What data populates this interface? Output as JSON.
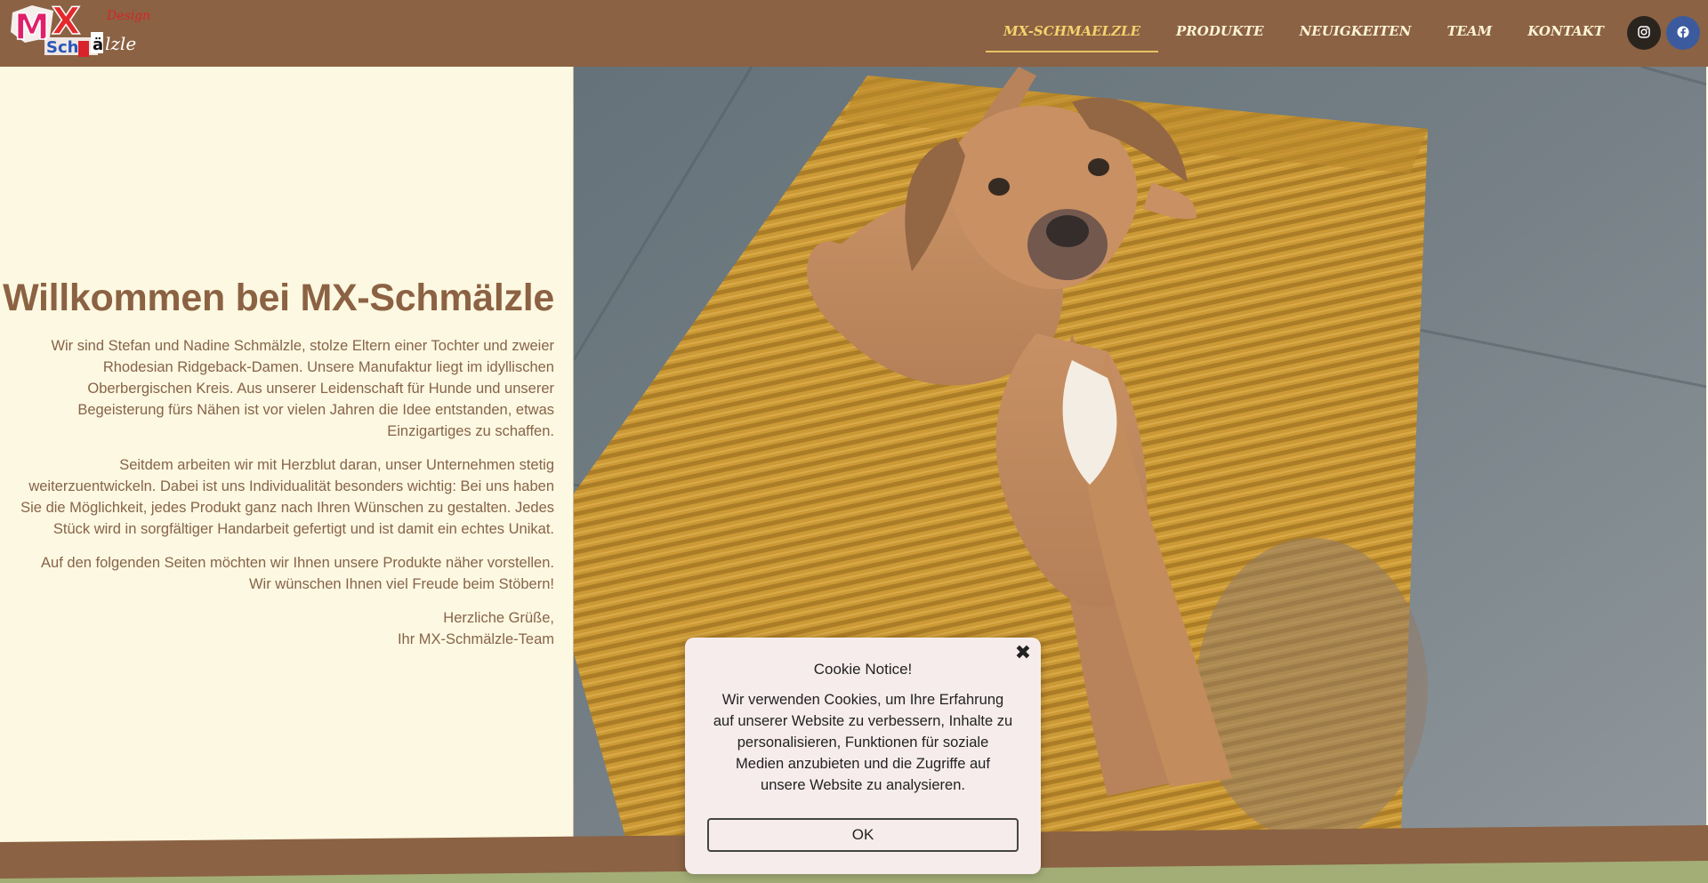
{
  "logo": {
    "text_main": "MX",
    "text_sub": "Schmälzle",
    "text_script": "Design"
  },
  "nav": {
    "items": [
      {
        "label": "MX-SCHMAELZLE",
        "active": true
      },
      {
        "label": "PRODUKTE",
        "active": false
      },
      {
        "label": "NEUIGKEITEN",
        "active": false
      },
      {
        "label": "TEAM",
        "active": false
      },
      {
        "label": "KONTAKT",
        "active": false
      }
    ]
  },
  "social": {
    "instagram_icon": "instagram-icon",
    "facebook_icon": "facebook-icon"
  },
  "intro": {
    "title": "Willkommen bei MX-Schmälzle",
    "paragraphs": [
      "Wir sind Stefan und Nadine Schmälzle, stolze Eltern einer Tochter und zweier Rhodesian Ridgeback-Damen. Unsere Manufaktur liegt im idyllischen Oberbergischen Kreis. Aus unserer Leidenschaft für Hunde und unserer Begeisterung fürs Nähen ist vor vielen Jahren die Idee entstanden, etwas Einzigartiges zu schaffen.",
      "Seitdem arbeiten wir mit Herzblut daran, unser Unternehmen stetig weiterzuentwickeln. Dabei ist uns Individualität besonders wichtig: Bei uns haben Sie die Möglichkeit, jedes Produkt ganz nach Ihren Wünschen zu gestalten. Jedes Stück wird in sorgfältiger Handarbeit gefertigt und ist damit ein echtes Unikat.",
      "Auf den folgenden Seiten möchten wir Ihnen unsere Produkte näher vorstellen. Wir wünschen Ihnen viel Freude beim Stöbern!"
    ],
    "greeting_line1": "Herzliche Grüße,",
    "greeting_line2": "Ihr MX-Schmälzle-Team"
  },
  "cookie": {
    "title": "Cookie Notice!",
    "text": "Wir verwenden Cookies, um Ihre Erfahrung auf unserer Website zu verbessern, Inhalte zu personalisieren, Funktionen für soziale Medien anzubieten und die Zugriffe auf unsere Website zu analysieren.",
    "ok_label": "OK",
    "close_glyph": "✖"
  },
  "colors": {
    "header": "#8b6243",
    "page_bg": "#fdf8e1",
    "title": "#8b6243",
    "nav_active": "#f3d36e",
    "bottom_green": "#a3ae77"
  }
}
